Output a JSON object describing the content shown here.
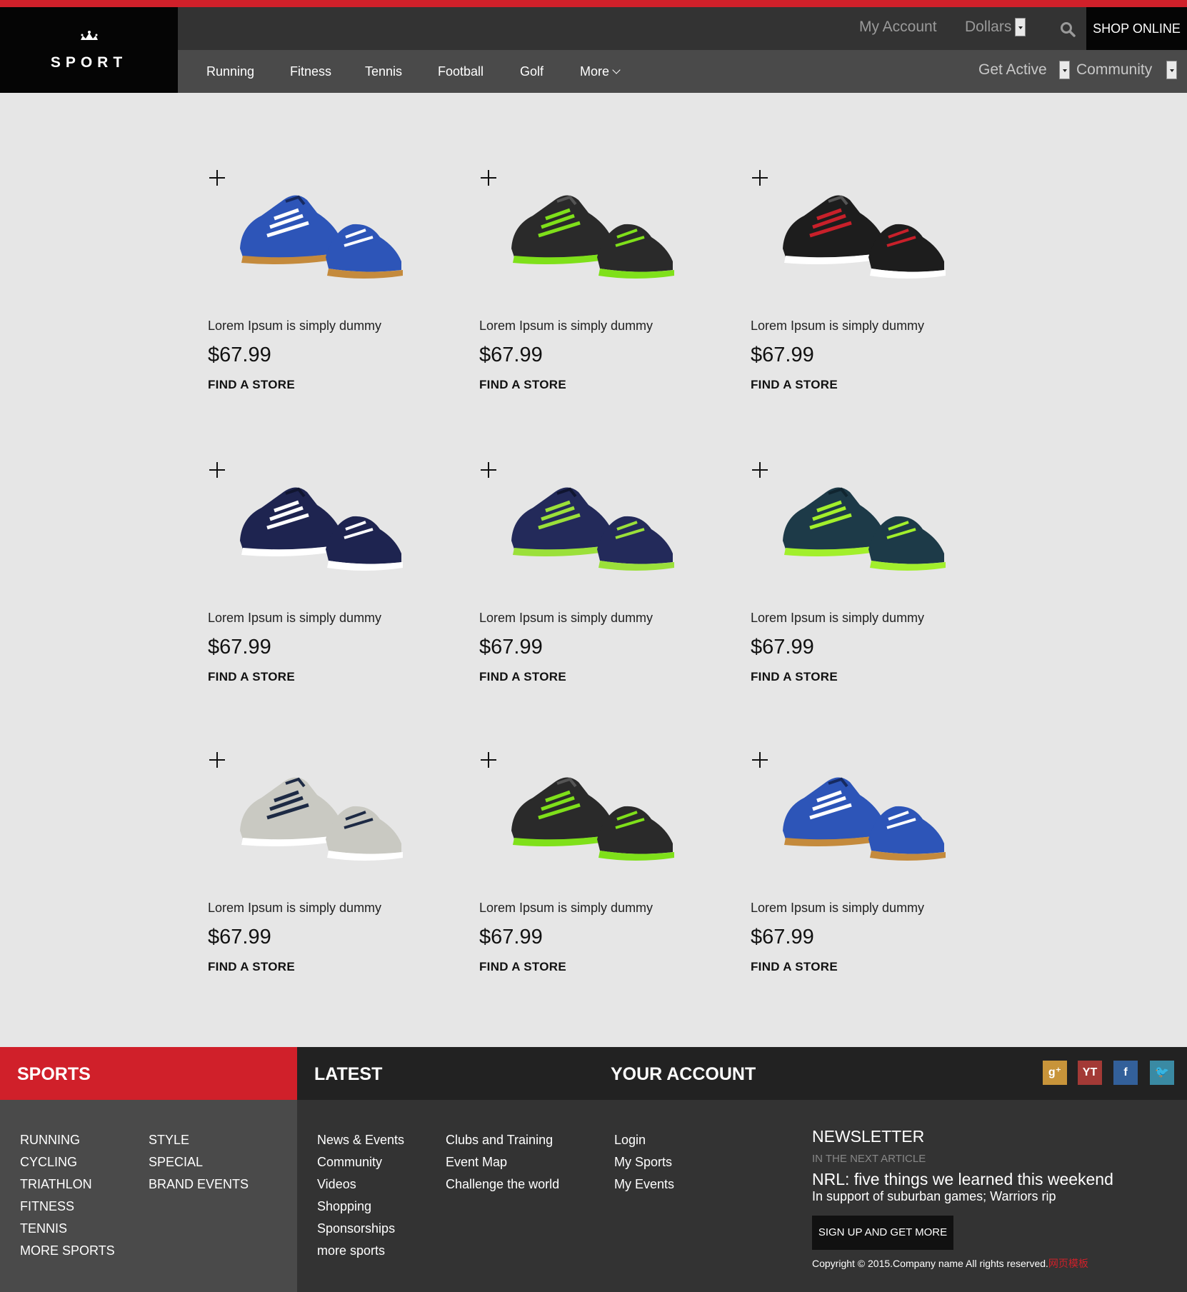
{
  "header": {
    "logo_text": "SPORT",
    "my_account": "My Account",
    "currency": "Dollars",
    "shop_online": "SHOP ONLINE",
    "nav": [
      "Running",
      "Fitness",
      "Tennis",
      "Football",
      "Golf",
      "More"
    ],
    "get_active": "Get Active",
    "community": "Community"
  },
  "products": [
    {
      "desc": "Lorem Ipsum is simply dummy",
      "price": "$67.99",
      "cta": "FIND A STORE",
      "icon": "blue-shoe-icon"
    },
    {
      "desc": "Lorem Ipsum is simply dummy",
      "price": "$67.99",
      "cta": "FIND A STORE",
      "icon": "black-green-shoe-icon"
    },
    {
      "desc": "Lorem Ipsum is simply dummy",
      "price": "$67.99",
      "cta": "FIND A STORE",
      "icon": "black-red-shoe-icon"
    },
    {
      "desc": "Lorem Ipsum is simply dummy",
      "price": "$67.99",
      "cta": "FIND A STORE",
      "icon": "navy-shoe-icon"
    },
    {
      "desc": "Lorem Ipsum is simply dummy",
      "price": "$67.99",
      "cta": "FIND A STORE",
      "icon": "navy-lime-shoe-icon"
    },
    {
      "desc": "Lorem Ipsum is simply dummy",
      "price": "$67.99",
      "cta": "FIND A STORE",
      "icon": "teal-lime-shoe-icon"
    },
    {
      "desc": "Lorem Ipsum is simply dummy",
      "price": "$67.99",
      "cta": "FIND A STORE",
      "icon": "grey-navy-shoe-icon"
    },
    {
      "desc": "Lorem Ipsum is simply dummy",
      "price": "$67.99",
      "cta": "FIND A STORE",
      "icon": "black-green-shoe-icon"
    },
    {
      "desc": "Lorem Ipsum is simply dummy",
      "price": "$67.99",
      "cta": "FIND A STORE",
      "icon": "blue-shoe-icon"
    }
  ],
  "footer": {
    "sports_heading": "SPORTS",
    "latest_heading": "LATEST",
    "account_heading": "YOUR ACCOUNT",
    "sports_col1": [
      "RUNNING",
      "CYCLING",
      "TRIATHLON",
      "FITNESS",
      "TENNIS",
      "MORE SPORTS"
    ],
    "sports_col2": [
      "STYLE",
      "SPECIAL",
      "BRAND EVENTS"
    ],
    "latest_col1": [
      "News & Events",
      "Community",
      "Videos",
      "Shopping",
      "Sponsorships",
      "more sports"
    ],
    "latest_col2": [
      "Clubs and Training",
      "Event Map",
      "Challenge the world"
    ],
    "account_links": [
      "Login",
      "My Sports",
      "My Events"
    ],
    "social": [
      {
        "icon": "google-plus-icon",
        "glyph": "g⁺",
        "color": "#c8943a"
      },
      {
        "icon": "youtube-icon",
        "glyph": "YT",
        "color": "#a33a36"
      },
      {
        "icon": "facebook-icon",
        "glyph": "f",
        "color": "#33609a"
      },
      {
        "icon": "twitter-icon",
        "glyph": "🐦",
        "color": "#3a8aa3"
      }
    ],
    "newsletter": {
      "title": "NEWSLETTER",
      "sub": "IN THE NEXT ARTICLE",
      "headline": "NRL: five things we learned this weekend",
      "desc": "In support of suburban games; Warriors rip",
      "button": "SIGN UP AND GET MORE"
    },
    "copyright": "Copyright © 2015.Company name All rights reserved.",
    "copyright_red": "网页模板"
  },
  "colors": {
    "accent": "#d0202a",
    "header_dark": "#333333",
    "nav_grey": "#4a4a4a",
    "footer_dark": "#222222"
  }
}
